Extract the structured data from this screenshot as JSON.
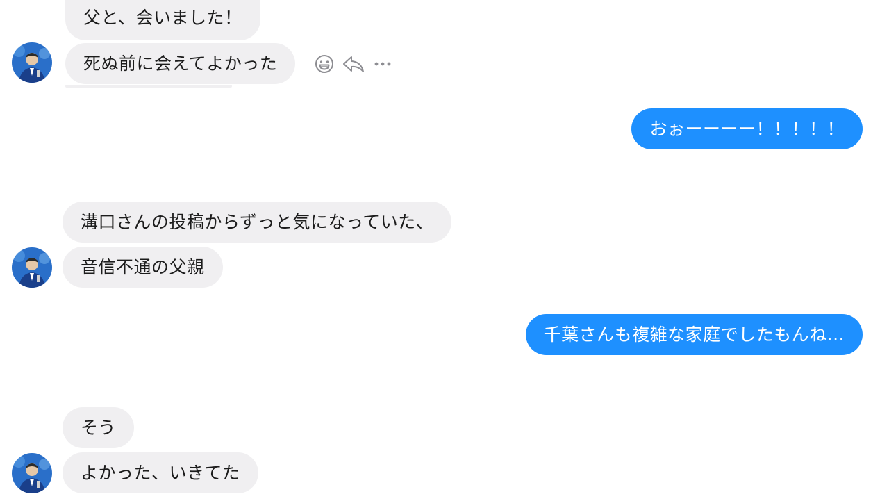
{
  "conversation": {
    "messages": [
      {
        "sender": "them",
        "text": "父と、会いました！"
      },
      {
        "sender": "them",
        "text": "死ぬ前に会えてよかった"
      },
      {
        "sender": "me",
        "text": "おぉーーーー！！！！！"
      },
      {
        "sender": "them",
        "text": "溝口さんの投稿からずっと気になっていた、"
      },
      {
        "sender": "them",
        "text": "音信不通の父親"
      },
      {
        "sender": "me",
        "text": "千葉さんも複雑な家庭でしたもんね..."
      },
      {
        "sender": "them",
        "text": "そう"
      },
      {
        "sender": "them",
        "text": "よかった、いきてた"
      }
    ]
  },
  "message_actions": {
    "icons": [
      "emoji-reaction-icon",
      "reply-icon",
      "more-options-icon"
    ]
  },
  "colors": {
    "incoming_bubble": "#f0eff1",
    "outgoing_bubble": "#1e90ff",
    "incoming_text": "#1c1c1c",
    "outgoing_text": "#ffffff",
    "icon_gray": "#8d8d92"
  }
}
